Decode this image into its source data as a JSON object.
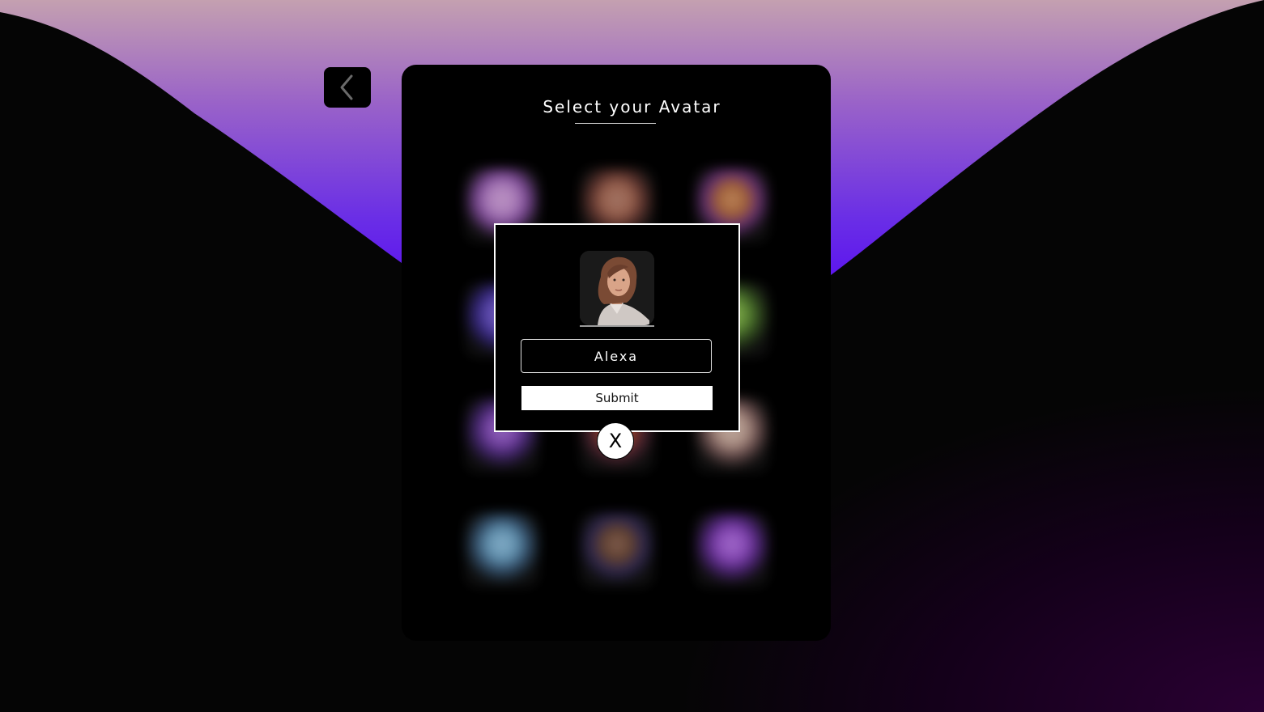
{
  "header": {
    "title": "Select your Avatar",
    "back_icon": "chevron-left-icon"
  },
  "avatars": [
    {
      "name": "avatar-1",
      "accent": "#c48fd6"
    },
    {
      "name": "avatar-2",
      "accent": "#b0705a"
    },
    {
      "name": "avatar-3",
      "accent": "#b86d3d"
    },
    {
      "name": "avatar-4",
      "accent": "#6a55c8"
    },
    {
      "name": "avatar-5",
      "accent": "#7a4f3a"
    },
    {
      "name": "avatar-6",
      "accent": "#6ea23e"
    },
    {
      "name": "avatar-7",
      "accent": "#8a4fc0"
    },
    {
      "name": "avatar-8",
      "accent": "#a0442c"
    },
    {
      "name": "avatar-9",
      "accent": "#c9a89a"
    },
    {
      "name": "avatar-10",
      "accent": "#6fa6c9"
    },
    {
      "name": "avatar-11",
      "accent": "#6e4a36"
    },
    {
      "name": "avatar-12",
      "accent": "#9a52d0"
    }
  ],
  "modal": {
    "name_value": "Alexa",
    "submit_label": "Submit",
    "close_label": "X"
  },
  "colors": {
    "accent_purple": "#5a10f0",
    "accent_pink": "#c4a0b0",
    "panel_bg": "#000000"
  }
}
